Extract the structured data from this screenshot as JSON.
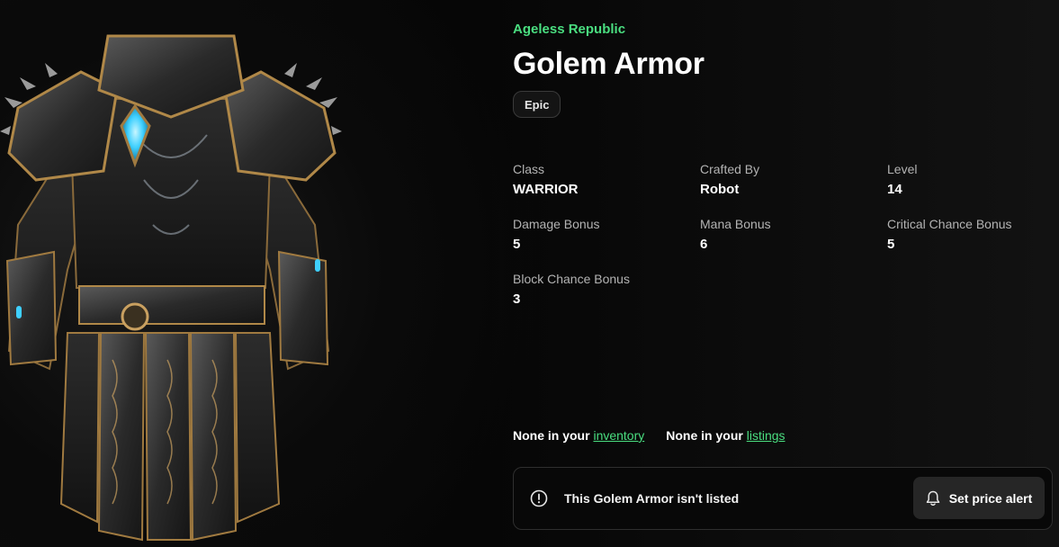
{
  "item": {
    "collection": "Ageless Republic",
    "name": "Golem Armor",
    "rarity": "Epic"
  },
  "stats": [
    {
      "label": "Class",
      "value": "WARRIOR"
    },
    {
      "label": "Crafted By",
      "value": "Robot"
    },
    {
      "label": "Level",
      "value": "14"
    },
    {
      "label": "Damage Bonus",
      "value": "5"
    },
    {
      "label": "Mana Bonus",
      "value": "6"
    },
    {
      "label": "Critical Chance Bonus",
      "value": "5"
    },
    {
      "label": "Block Chance Bonus",
      "value": "3"
    }
  ],
  "ownership": {
    "inventory_prefix": "None in your",
    "inventory_link": "inventory",
    "listings_prefix": "None in your",
    "listings_link": "listings"
  },
  "listing": {
    "status_text": "This Golem Armor isn't listed",
    "alert_button": "Set price alert",
    "info_icon": "info-circle-icon",
    "bell_icon": "bell-icon"
  },
  "colors": {
    "accent": "#4ade80",
    "background": "#050505",
    "button_bg": "#262626",
    "gem": "#3fd0ff"
  }
}
